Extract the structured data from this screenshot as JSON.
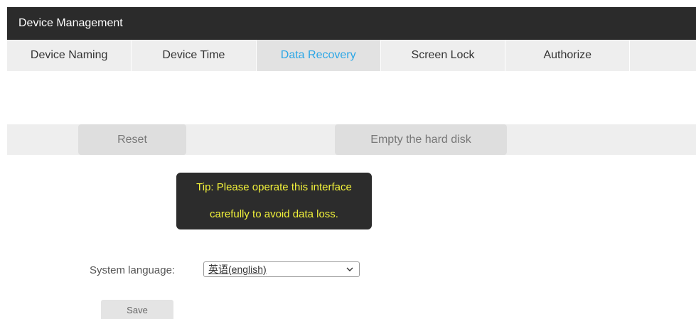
{
  "header": {
    "title": "Device Management"
  },
  "tabs": [
    {
      "label": "Device Naming",
      "active": false
    },
    {
      "label": "Device Time",
      "active": false
    },
    {
      "label": "Data Recovery",
      "active": true
    },
    {
      "label": "Screen Lock",
      "active": false
    },
    {
      "label": "Authorize",
      "active": false
    }
  ],
  "actions": {
    "reset_label": "Reset",
    "empty_disk_label": "Empty the hard disk"
  },
  "tip": {
    "line1": "Tip: Please operate this interface",
    "line2": "carefully to avoid data loss."
  },
  "language": {
    "label": "System language:",
    "selected": "英语(english)"
  },
  "save_label": "Save",
  "colors": {
    "titlebar": "#2b2b2b",
    "active_tab_text": "#2aa6e6",
    "tip_text": "#f2f23a",
    "tip_background": "#2c2c2c"
  },
  "icons": {
    "select_arrow": "chevron-down-icon"
  }
}
